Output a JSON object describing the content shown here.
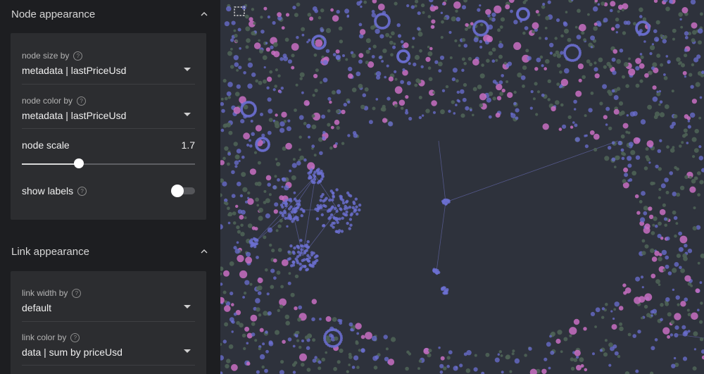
{
  "node_appearance": {
    "title": "Node appearance",
    "size_by": {
      "label": "node size by",
      "value": "metadata | lastPriceUsd"
    },
    "color_by": {
      "label": "node color by",
      "value": "metadata | lastPriceUsd"
    },
    "scale": {
      "label": "node scale",
      "value": "1.7",
      "fraction": 0.33
    },
    "labels": {
      "label": "show labels",
      "enabled": false
    }
  },
  "link_appearance": {
    "title": "Link appearance",
    "width_by": {
      "label": "link width by",
      "value": "default"
    },
    "color_by": {
      "label": "link color by",
      "value": "data | sum by priceUsd"
    }
  },
  "colors": {
    "node_purple": "#6b6fd1",
    "node_pink": "#c86fc2",
    "node_grey": "#4e6255",
    "background": "#2e323c",
    "panel": "#1d1e21"
  },
  "icons": {
    "select": "selection-box-icon",
    "collapse": "chevron-up-icon",
    "dropdown": "caret-down-icon",
    "help": "help-icon"
  }
}
